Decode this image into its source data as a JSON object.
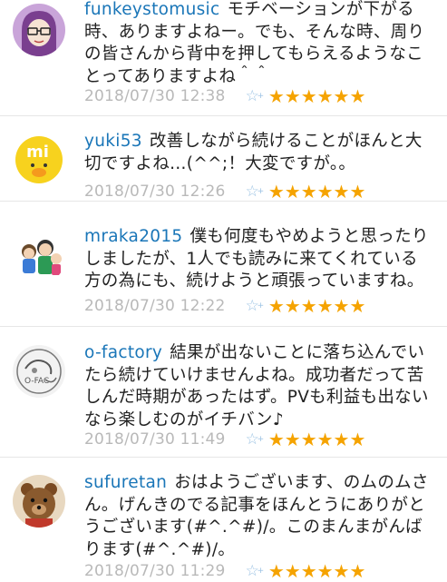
{
  "comments": [
    {
      "user": "funkeystomusic",
      "text": "モチベーションが下がる時、ありますよねー。でも、そんな時、周りの皆さんから背中を押してもらえるようなことってありますよね＾＾",
      "time": "2018/07/30 12:38",
      "add_star": "☆",
      "stars": "★★★★★★"
    },
    {
      "user": "yuki53",
      "text": "改善しながら続けることがほんと大切ですよね…(^^;！大変ですが。。",
      "time": "2018/07/30 12:26",
      "add_star": "☆",
      "stars": "★★★★★★"
    },
    {
      "user": "mraka2015",
      "text": "僕も何度もやめようと思ったりしましたが、1人でも読みに来てくれている方の為にも、続けようと頑張っていますね。",
      "time": "2018/07/30 12:22",
      "add_star": "☆",
      "stars": "★★★★★★"
    },
    {
      "user": "o-factory",
      "text": "結果が出ないことに落ち込んでいたら続けていけませんよね。成功者だって苦しんだ時期があったはず。PVも利益も出ないなら楽しむのがイチバン♪",
      "time": "2018/07/30 11:49",
      "add_star": "☆",
      "stars": "★★★★★★"
    },
    {
      "user": "sufuretan",
      "text": "おはようございます、のムのムさん。げんきのでる記事をほんとうにありがとうございます(#^.^#)/。このまんまがんばります(#^.^#)/。",
      "time": "2018/07/30 11:29",
      "add_star": "☆",
      "stars": "★★★★★★"
    }
  ],
  "plus_sign": "+"
}
